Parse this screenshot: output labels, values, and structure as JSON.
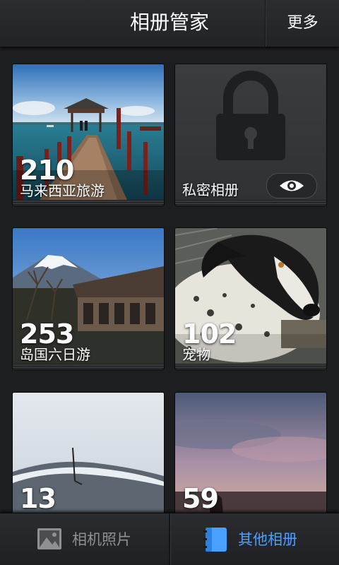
{
  "header": {
    "title": "相册管家",
    "more_label": "更多"
  },
  "albums": [
    {
      "count": "210",
      "name": "马来西亚旅游",
      "icon": "photo-pier"
    },
    {
      "count": "",
      "name": "私密相册",
      "icon": "lock-icon",
      "toggle_icon": "eye-icon"
    },
    {
      "count": "253",
      "name": "岛国六日游",
      "icon": "photo-mountain"
    },
    {
      "count": "102",
      "name": "宠物",
      "icon": "photo-dog"
    },
    {
      "count": "13",
      "name": "",
      "icon": "photo-snow"
    },
    {
      "count": "59",
      "name": "",
      "icon": "photo-sunset"
    }
  ],
  "tabs": [
    {
      "label": "相机照片",
      "icon": "image-icon",
      "active": false
    },
    {
      "label": "其他相册",
      "icon": "album-book-icon",
      "active": true
    }
  ],
  "colors": {
    "active_tab": "#4aa0ff",
    "inactive_tab": "#8e9094",
    "background": "#1d1e20"
  }
}
